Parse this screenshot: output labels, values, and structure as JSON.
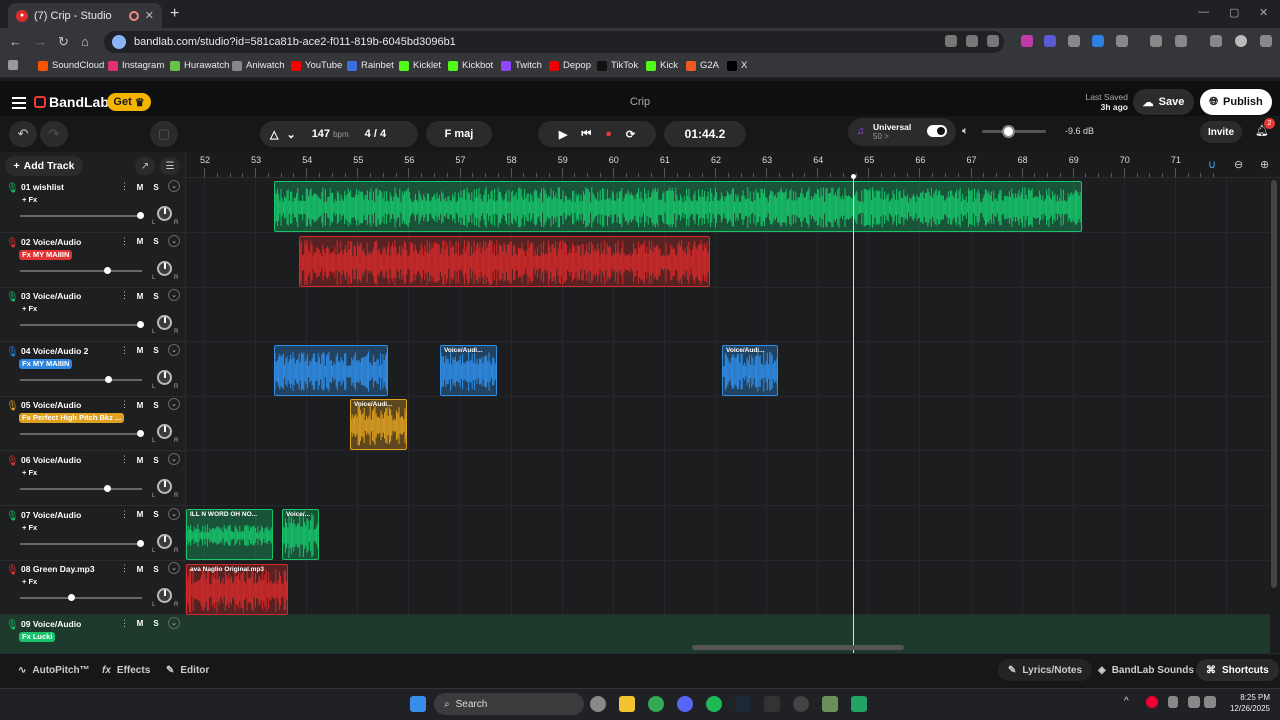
{
  "browser": {
    "tab_title": "(7) Crip - Studio",
    "tab_close": "✕",
    "new_tab": "+",
    "url": "bandlab.com/studio?id=581ca81b-ace2-f011-819b-6045bd3096b1",
    "bookmarks": [
      "SoundCloud",
      "Instagram",
      "Hurawatch",
      "Aniwatch",
      "YouTube",
      "Rainbet",
      "Kicklet",
      "Kickbot",
      "Twitch",
      "Depop",
      "TikTok",
      "Kick",
      "G2A",
      "X"
    ],
    "bookmark_colors": [
      "#ff5500",
      "#e1306c",
      "#6ac14a",
      "#888888",
      "#ff0000",
      "#3b6fe0",
      "#53fc18",
      "#53fc18",
      "#9146ff",
      "#e00",
      "#111",
      "#53fc18",
      "#f05a22",
      "#000"
    ]
  },
  "app": {
    "brand": "BandLab",
    "get_label": "Get",
    "project_name": "Crip",
    "last_saved_label": "Last Saved",
    "last_saved_value": "3h ago",
    "save_label": "Save",
    "publish_label": "Publish"
  },
  "transport": {
    "bpm": "147",
    "bpm_unit": "bpm",
    "time_sig": "4 / 4",
    "key": "F maj",
    "time": "01:44.2",
    "universal_label": "Universal",
    "universal_value": "50 >",
    "volume_db": "-9.6 dB",
    "invite_label": "Invite",
    "notifications": "2"
  },
  "panel": {
    "add_track_label": "Add Track"
  },
  "ruler": {
    "bars": [
      "52",
      "53",
      "54",
      "55",
      "56",
      "57",
      "58",
      "59",
      "60",
      "61",
      "62",
      "63",
      "64",
      "65",
      "66",
      "67",
      "68",
      "69",
      "70",
      "71"
    ]
  },
  "tracks": [
    {
      "name": "01  wishlist",
      "fx": "+ Fx",
      "fx_color": "",
      "color": "#19c26b",
      "vol": 0.99
    },
    {
      "name": "02  Voice/Audio",
      "fx": "Fx MY MAIIIN",
      "fx_color": "#e03434",
      "color": "#e03434",
      "vol": 0.71
    },
    {
      "name": "03  Voice/Audio",
      "fx": "+ Fx",
      "fx_color": "",
      "color": "#19c26b",
      "vol": 0.99
    },
    {
      "name": "04  Voice/Audio 2",
      "fx": "Fx MY MAIIIN",
      "fx_color": "#2f86e0",
      "color": "#2f86e0",
      "vol": 0.72
    },
    {
      "name": "05  Voice/Audio",
      "fx": "Fx Perfect High Pitch Bkz ...",
      "fx_color": "#e0a020",
      "color": "#e0a020",
      "vol": 0.99
    },
    {
      "name": "06  Voice/Audio",
      "fx": "+ Fx",
      "fx_color": "",
      "color": "#e03434",
      "vol": 0.71
    },
    {
      "name": "07  Voice/Audio",
      "fx": "+ Fx",
      "fx_color": "",
      "color": "#19c26b",
      "vol": 0.99
    },
    {
      "name": "08  Green Day.mp3",
      "fx": "+ Fx",
      "fx_color": "",
      "color": "#e03434",
      "vol": 0.41
    },
    {
      "name": "09  Voice/Audio",
      "fx": "Fx Lucki",
      "fx_color": "#19c26b",
      "color": "#19c26b",
      "vol": 0.99
    }
  ],
  "clips": [
    {
      "track": 0,
      "label": "",
      "color": "#17c46b"
    },
    {
      "track": 1,
      "label": "",
      "color": "#d12a2a"
    },
    {
      "track": 3,
      "label": "",
      "color": "#2f8de8"
    },
    {
      "track": 3,
      "label": "Voice/Audi...",
      "color": "#2f8de8"
    },
    {
      "track": 3,
      "label": "Voice/Audi...",
      "color": "#2f8de8"
    },
    {
      "track": 4,
      "label": "Voice/Audi...",
      "color": "#e0a020"
    },
    {
      "track": 6,
      "label": "ILL N WORD OH NO...",
      "color": "#17c46b"
    },
    {
      "track": 6,
      "label": "Voice/...",
      "color": "#17c46b"
    },
    {
      "track": 7,
      "label": "ava Naglio Original.mp3",
      "color": "#d12a2a"
    }
  ],
  "bottom": {
    "autopitch": "AutoPitch™",
    "effects": "Effects",
    "editor": "Editor",
    "lyrics": "Lyrics/Notes",
    "sounds": "BandLab Sounds",
    "shortcuts": "Shortcuts"
  },
  "taskbar": {
    "search_label": "Search",
    "time": "8:25 PM",
    "date": "12/26/2025"
  }
}
